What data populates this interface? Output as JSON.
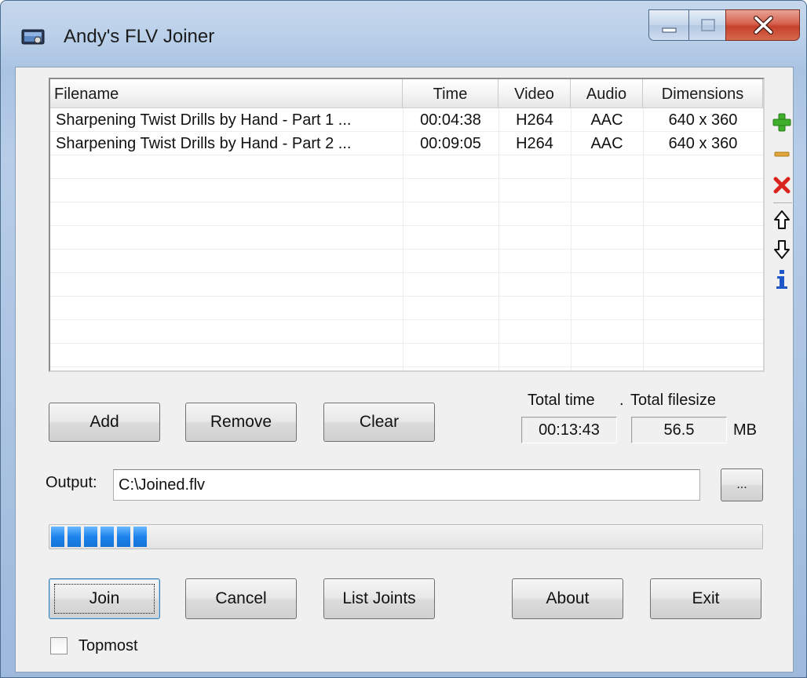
{
  "window": {
    "title": "Andy's FLV Joiner"
  },
  "filelist": {
    "columns": [
      {
        "key": "filename",
        "label": "Filename"
      },
      {
        "key": "time",
        "label": "Time"
      },
      {
        "key": "video",
        "label": "Video"
      },
      {
        "key": "audio",
        "label": "Audio"
      },
      {
        "key": "dimensions",
        "label": "Dimensions"
      }
    ],
    "rows": [
      {
        "filename": "Sharpening Twist Drills by Hand - Part 1 ...",
        "time": "00:04:38",
        "video": "H264",
        "audio": "AAC",
        "dimensions": "640 x 360"
      },
      {
        "filename": "Sharpening Twist Drills by Hand - Part 2 ...",
        "time": "00:09:05",
        "video": "H264",
        "audio": "AAC",
        "dimensions": "640 x 360"
      }
    ]
  },
  "side_tools": [
    "plus-icon",
    "minus-icon",
    "delete-icon",
    "move-up-icon",
    "move-down-icon",
    "info-icon"
  ],
  "buttons": {
    "add": "Add",
    "remove": "Remove",
    "clear": "Clear",
    "browse": "...",
    "join": "Join",
    "cancel": "Cancel",
    "list_joints": "List Joints",
    "about": "About",
    "exit": "Exit"
  },
  "totals": {
    "total_time_label": "Total time",
    "separator": ".",
    "total_filesize_label": "Total filesize",
    "total_time": "00:13:43",
    "total_filesize": "56.5",
    "size_unit": "MB"
  },
  "output": {
    "label": "Output:",
    "value": "C:\\Joined.flv"
  },
  "progress": {
    "value_percent": 14
  },
  "topmost": {
    "label": "Topmost",
    "checked": false
  },
  "colors": {
    "progress_fill": "#1c83ec",
    "add_icon": "#3fae2a",
    "delete_icon": "#d9261c",
    "arrow_icon": "#1e56c8"
  }
}
